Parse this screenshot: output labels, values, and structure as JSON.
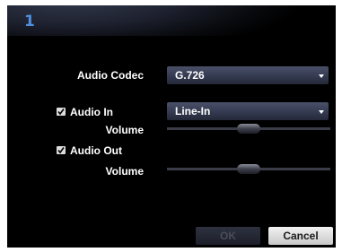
{
  "window": {
    "title": "1"
  },
  "audio_codec": {
    "label": "Audio Codec",
    "value": "G.726"
  },
  "audio_in": {
    "label": "Audio In",
    "checked": true,
    "source_value": "Line-In",
    "volume_label": "Volume",
    "volume_level": 0.5
  },
  "audio_out": {
    "label": "Audio Out",
    "checked": true,
    "volume_label": "Volume",
    "volume_level": 0.5
  },
  "buttons": {
    "ok_label": "OK",
    "ok_enabled": false,
    "cancel_label": "Cancel"
  },
  "icons": {
    "dropdown_arrow": "chevron-down-icon",
    "checkbox_mark": "check-icon"
  },
  "colors": {
    "title": "#4e8fe0",
    "background": "#000000",
    "text": "#ffffff"
  }
}
